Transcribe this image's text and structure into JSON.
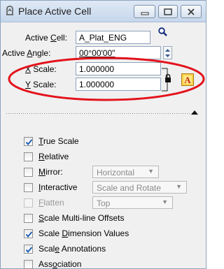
{
  "window": {
    "title": "Place Active Cell"
  },
  "fields": {
    "active_cell": {
      "label_pre": "Active ",
      "label_key": "C",
      "label_post": "ell:",
      "value": "A_Plat_ENG"
    },
    "active_angle": {
      "label_pre": "Active ",
      "label_key": "A",
      "label_post": "ngle:",
      "value": "00°00'00\""
    },
    "x_scale": {
      "label_key": "X",
      "label_post": " Scale:",
      "value": "1.000000"
    },
    "y_scale": {
      "label_key": "Y",
      "label_post": " Scale:",
      "value": "1.000000"
    }
  },
  "options": {
    "true_scale": {
      "key": "T",
      "rest": "rue Scale",
      "checked": true
    },
    "relative": {
      "key": "R",
      "rest": "elative",
      "checked": false
    },
    "mirror": {
      "key": "M",
      "rest": "irror:",
      "checked": false,
      "select": "Horizontal"
    },
    "interactive": {
      "key": "I",
      "rest": "nteractive",
      "checked": false,
      "select": "Scale and Rotate"
    },
    "flatten": {
      "key": "F",
      "rest": "latten",
      "checked": false,
      "disabled": true,
      "select": "Top"
    },
    "multiline": {
      "key": "S",
      "rest": "cale Multi-line Offsets",
      "checked": false
    },
    "dimension": {
      "pre": "Scale ",
      "key": "D",
      "rest": "imension Values",
      "checked": true
    },
    "annotations": {
      "pre": "Scal",
      "key": "e",
      "rest": " Annotations",
      "checked": true
    },
    "association": {
      "pre": "Ass",
      "key": "o",
      "rest": "ciation",
      "checked": false
    }
  },
  "colors": {
    "highlight_ellipse": "#e3121b",
    "check": "#1f5fb4",
    "titlebar": "#c6d7ec"
  }
}
